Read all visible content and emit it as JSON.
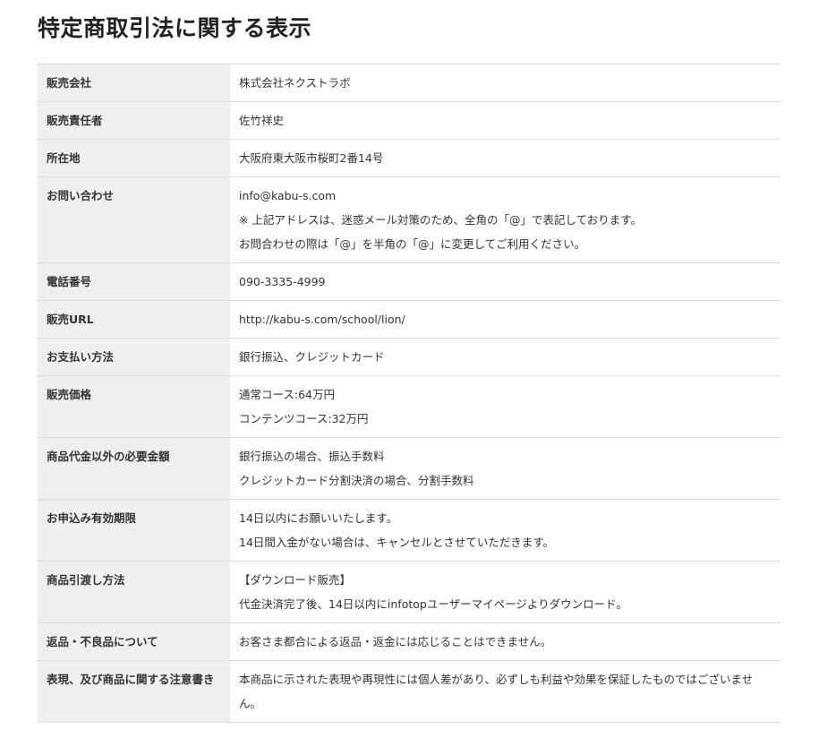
{
  "page": {
    "title": "特定商取引法に関する表示"
  },
  "rows": [
    {
      "label": "販売会社",
      "lines": [
        "株式会社ネクストラボ"
      ]
    },
    {
      "label": "販売責任者",
      "lines": [
        "佐竹祥史"
      ]
    },
    {
      "label": "所在地",
      "lines": [
        "大阪府東大阪市桜町2番14号"
      ]
    },
    {
      "label": "お問い合わせ",
      "lines": [
        "info@kabu-s.com",
        "※ 上記アドレスは、迷惑メール対策のため、全角の「@」で表記しております。",
        "お問合わせの際は「@」を半角の「@」に変更してご利用ください。"
      ]
    },
    {
      "label": "電話番号",
      "lines": [
        "090-3335-4999"
      ]
    },
    {
      "label": "販売URL",
      "lines": [
        "http://kabu-s.com/school/lion/"
      ]
    },
    {
      "label": "お支払い方法",
      "lines": [
        "銀行振込、クレジットカード"
      ]
    },
    {
      "label": "販売価格",
      "lines": [
        "通常コース:64万円",
        "コンテンツコース:32万円"
      ]
    },
    {
      "label": "商品代金以外の必要金額",
      "lines": [
        "銀行振込の場合、振込手数料",
        "クレジットカード分割決済の場合、分割手数料"
      ]
    },
    {
      "label": "お申込み有効期限",
      "lines": [
        "14日以内にお願いいたします。",
        "14日間入金がない場合は、キャンセルとさせていただきます。"
      ]
    },
    {
      "label": "商品引渡し方法",
      "lines": [
        "【ダウンロード販売】",
        "代金決済完了後、14日以内にinfotopユーザーマイページよりダウンロード。"
      ]
    },
    {
      "label": "返品・不良品について",
      "lines": [
        "お客さま都合による返品・返金には応じることはできません。"
      ]
    },
    {
      "label": "表現、及び商品に関する注意書き",
      "lines": [
        "本商品に示された表現や再現性には個人差があり、必ずしも利益や効果を保証したものではございません。"
      ]
    }
  ]
}
